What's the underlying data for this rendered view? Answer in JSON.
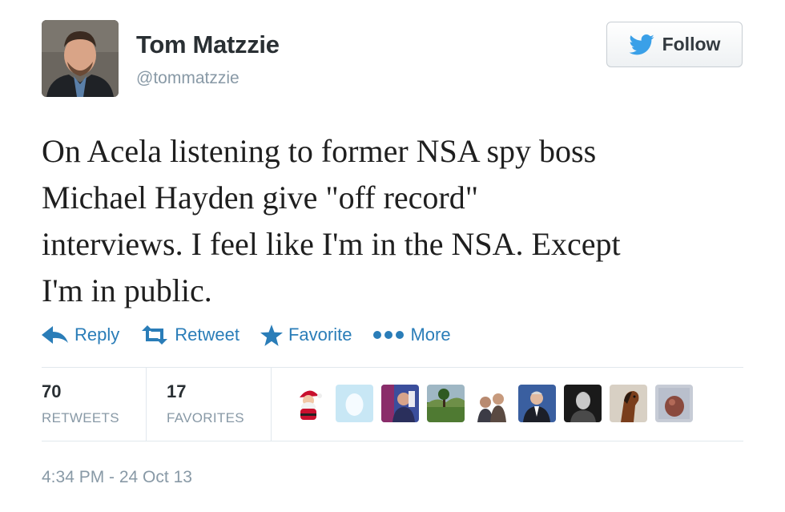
{
  "author": {
    "name": "Tom Matzzie",
    "handle": "@tommatzzie"
  },
  "follow_button": {
    "label": "Follow",
    "icon": "twitter-bird-icon"
  },
  "tweet": {
    "lines": [
      "On Acela listening to former NSA spy boss",
      "Michael Hayden give \"off record\"",
      "interviews. I feel like I'm in the NSA. Except",
      "I'm in public."
    ]
  },
  "actions": [
    {
      "label": "Reply",
      "icon": "reply-arrow-icon"
    },
    {
      "label": "Retweet",
      "icon": "retweet-icon"
    },
    {
      "label": "Favorite",
      "icon": "star-icon"
    },
    {
      "label": "More",
      "icon": "more-dots-icon"
    }
  ],
  "stats": {
    "retweets": {
      "count": "70",
      "label": "RETWEETS"
    },
    "favorites": {
      "count": "17",
      "label": "FAVORITES"
    }
  },
  "favoriters": [
    "santa-avatar",
    "default-egg-avatar",
    "person-avatar",
    "landscape-avatar",
    "couple-avatar",
    "man-in-suit-avatar",
    "portrait-avatar",
    "horse-avatar",
    "abstract-avatar"
  ],
  "timestamp": "4:34 PM - 24 Oct 13",
  "colors": {
    "link": "#2a7db8",
    "muted": "#8899a6",
    "twitter_blue": "#55acee"
  }
}
